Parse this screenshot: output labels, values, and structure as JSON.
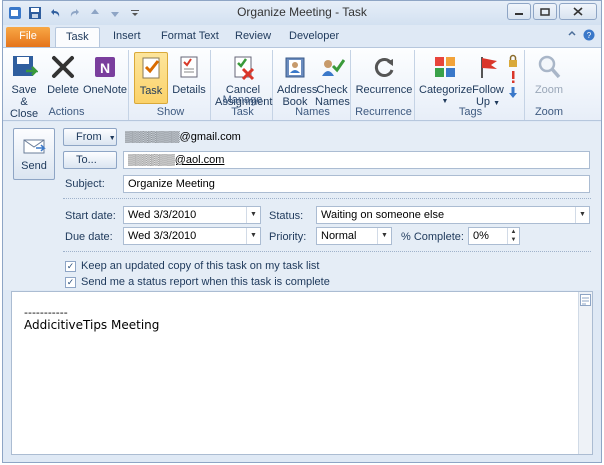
{
  "window": {
    "title": "Organize Meeting  -  Task"
  },
  "tabs": [
    "File",
    "Task",
    "Insert",
    "Format Text",
    "Review",
    "Developer"
  ],
  "ribbon": {
    "actions": {
      "label": "Actions",
      "save_close": "Save &\nClose",
      "delete": "Delete",
      "onenote": "OneNote"
    },
    "show": {
      "label": "Show",
      "task": "Task",
      "details": "Details"
    },
    "manage": {
      "label": "Manage Task",
      "cancel": "Cancel\nAssignment"
    },
    "names": {
      "label": "Names",
      "address": "Address\nBook",
      "check": "Check\nNames"
    },
    "recurrence": {
      "label": "Recurrence",
      "btn": "Recurrence"
    },
    "tags": {
      "label": "Tags",
      "categorize": "Categorize",
      "follow": "Follow\nUp"
    },
    "zoom": {
      "label": "Zoom",
      "btn": "Zoom"
    }
  },
  "form": {
    "send": "Send",
    "from_btn": "From",
    "from_value": "▒▒▒▒▒▒▒@gmail.com",
    "to_btn": "To...",
    "to_value": "▒▒▒▒▒▒@aol.com",
    "subject_label": "Subject:",
    "subject_value": "Organize Meeting",
    "start_label": "Start date:",
    "start_value": "Wed 3/3/2010",
    "due_label": "Due date:",
    "due_value": "Wed 3/3/2010",
    "status_label": "Status:",
    "status_value": "Waiting on someone else",
    "priority_label": "Priority:",
    "priority_value": "Normal",
    "complete_label": "% Complete:",
    "complete_value": "0%",
    "check1": "Keep an updated copy of this task on my task list",
    "check2": "Send me a status report when this task is complete"
  },
  "body": {
    "line1": "-----------",
    "line2": "AddicitiveTips Meeting"
  },
  "colors": {
    "file_tab": "#e5741b",
    "ribbon_bg": "#e7eef8",
    "active_btn": "#fbd26a"
  }
}
